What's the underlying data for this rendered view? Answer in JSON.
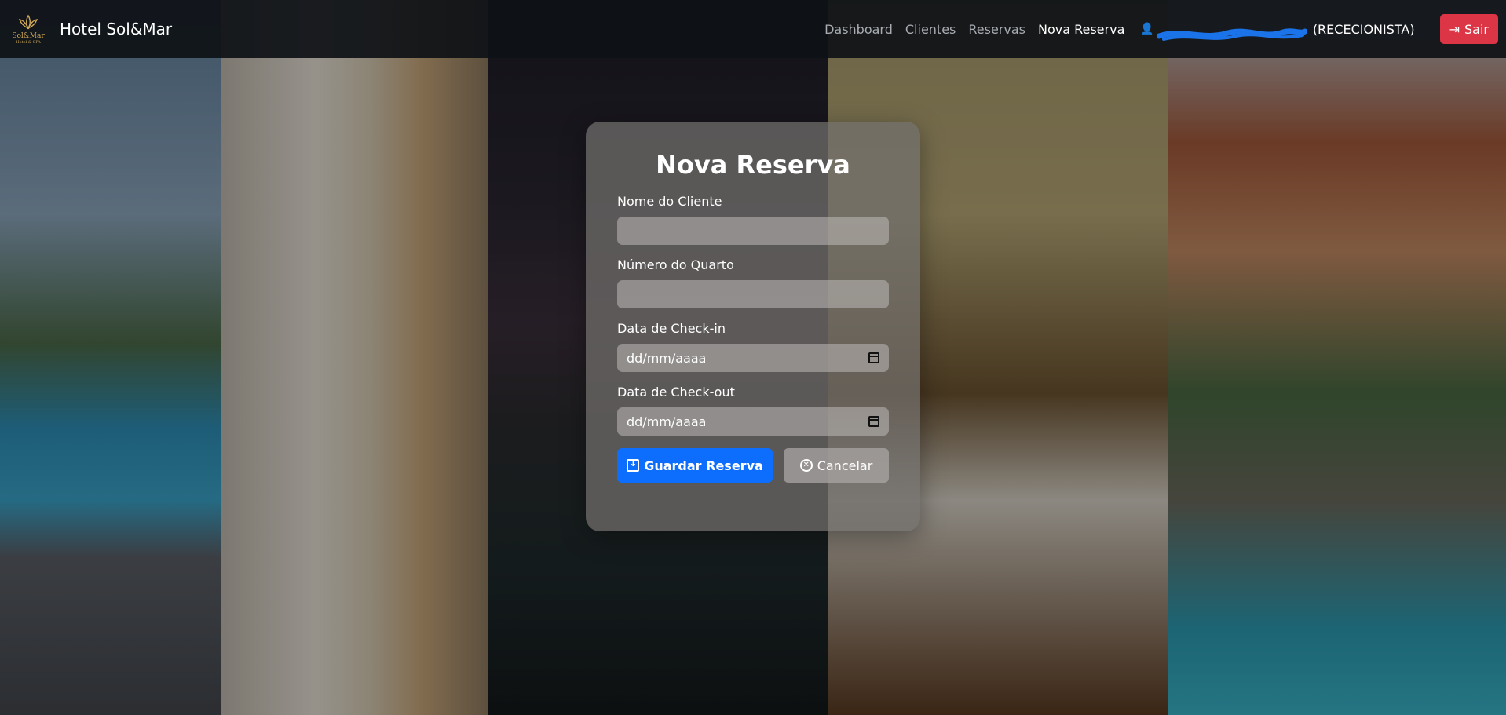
{
  "navbar": {
    "logo": {
      "line1": "Sol&Mar",
      "line2": "Hotel & SPA"
    },
    "brand": "Hotel Sol&Mar",
    "links": [
      {
        "label": "Dashboard",
        "active": false
      },
      {
        "label": "Clientes",
        "active": false
      },
      {
        "label": "Reservas",
        "active": false
      },
      {
        "label": "Nova Reserva",
        "active": true
      }
    ],
    "user": {
      "icon": "user-icon",
      "name": "(RECECIONISTA)"
    },
    "logout_label": "Sair"
  },
  "form": {
    "title": "Nova Reserva",
    "fields": {
      "client_name": {
        "label": "Nome do Cliente",
        "value": ""
      },
      "room_number": {
        "label": "Número do Quarto",
        "value": ""
      },
      "checkin": {
        "label": "Data de Check-in",
        "placeholder": "dd/mm/aaaa"
      },
      "checkout": {
        "label": "Data de Check-out",
        "placeholder": "dd/mm/aaaa"
      }
    },
    "save_label": "Guardar Reserva",
    "cancel_label": "Cancelar"
  },
  "colors": {
    "primary": "#0d6efd",
    "danger": "#dc3545",
    "navbar": "#0e1116",
    "gold": "#d3aa55"
  }
}
